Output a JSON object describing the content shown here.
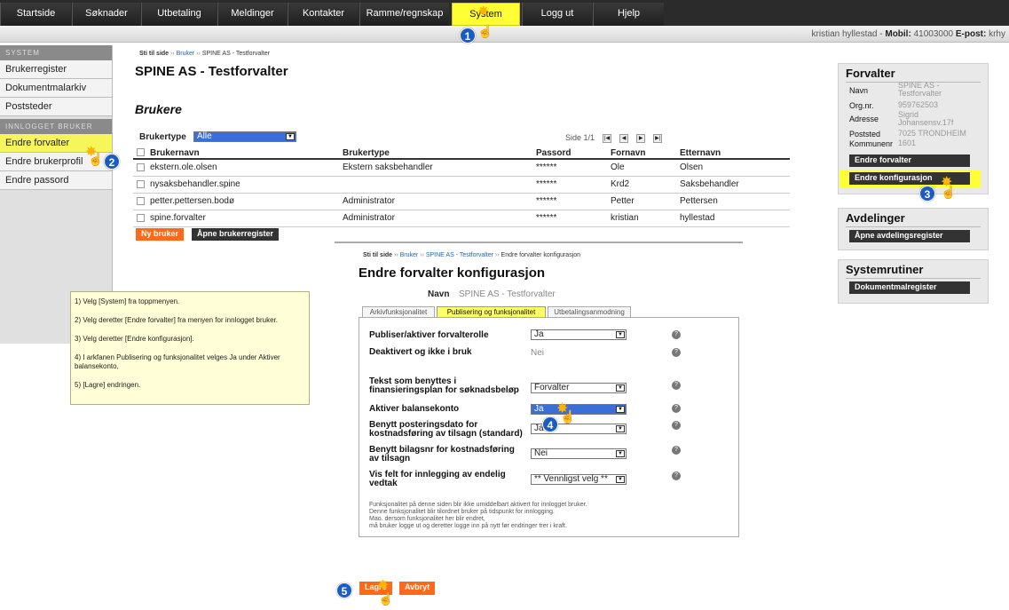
{
  "topnav": {
    "tabs": [
      "Startside",
      "Søknader",
      "Utbetaling",
      "Meldinger",
      "Kontakter",
      "Ramme/regnskap",
      "System",
      "Logg ut",
      "Hjelp"
    ],
    "active": "System"
  },
  "userbar": {
    "name": "kristian hyllestad",
    "mobile_label": "Mobil:",
    "mobile": "41003000",
    "email_label": "E-post:",
    "email": "krhy"
  },
  "sidebar": {
    "system_header": "SYSTEM",
    "system_items": [
      "Brukerregister",
      "Dokumentmalarkiv",
      "Poststeder"
    ],
    "user_header": "INNLOGGET BRUKER",
    "user_items": [
      "Endre forvalter",
      "Endre brukerprofil",
      "Endre passord"
    ]
  },
  "crumb1": {
    "start": "Sti til side",
    "items": [
      "Bruker",
      "SPINE AS - Testforvalter"
    ]
  },
  "page_title": "SPINE AS - Testforvalter",
  "section_title": "Brukere",
  "filter": {
    "label": "Brukertype",
    "value": "Alle"
  },
  "pager": {
    "text": "Side 1/1"
  },
  "users": {
    "headers": [
      "Brukernavn",
      "Brukertype",
      "Passord",
      "Fornavn",
      "Etternavn"
    ],
    "rows": [
      [
        "ekstern.ole.olsen",
        "Ekstern saksbehandler",
        "******",
        "Ole",
        "Olsen"
      ],
      [
        "nysaksbehandler.spine",
        "",
        "******",
        "Krd2",
        "Saksbehandler"
      ],
      [
        "petter.pettersen.bodø",
        "Administrator",
        "******",
        "Petter",
        "Pettersen"
      ],
      [
        "spine.forvalter",
        "Administrator",
        "******",
        "kristian",
        "hyllestad"
      ]
    ]
  },
  "buttons": {
    "new_user": "Ny bruker",
    "open_register": "Åpne brukerregister"
  },
  "right": {
    "forvalter_title": "Forvalter",
    "fields": [
      {
        "k": "Navn",
        "v": "SPINE AS - Testforvalter"
      },
      {
        "k": "Org.nr.",
        "v": "959762503"
      },
      {
        "k": "Adresse",
        "v": "Sigrid Johansensv.17f"
      },
      {
        "k": "Poststed",
        "v": "7025 TRONDHEIM"
      },
      {
        "k": "Kommunenr",
        "v": "1601"
      }
    ],
    "btn_edit": "Endre forvalter",
    "btn_config": "Endre konfigurasjon",
    "avd_title": "Avdelinger",
    "btn_avd": "Åpne avdelingsregister",
    "sys_title": "Systemrutiner",
    "btn_dok": "Dokumentmalregister"
  },
  "note": [
    "1) Velg [System] fra toppmenyen.",
    "2) Velg deretter [Endre forvalter] fra menyen for innlogget bruker.",
    "3) Velg deretter [Endre konfigurasjon].",
    "4) I arkfanen Publisering og funksjonalitet velges Ja under Aktiver balansekonto,",
    "5) [Lagre] endringen."
  ],
  "crumb2": {
    "start": "Sti til side",
    "items": [
      "Bruker",
      "SPINE AS - Testforvalter",
      "Endre forvalter konfigurasjon"
    ]
  },
  "config": {
    "title": "Endre forvalter konfigurasjon",
    "name_label": "Navn",
    "name_value": "SPINE AS - Testforvalter",
    "tabs": [
      "Arkivfunksjonalitet",
      "Publisering og funksjonalitet",
      "Utbetalingsanmodning"
    ],
    "rows": [
      {
        "label": "Publiser/aktiver forvalterolle",
        "value": "Ja"
      },
      {
        "label": "Deaktivert og ikke i bruk",
        "value": "Nei"
      },
      {
        "label": "Tekst som benyttes i finansieringsplan for søknadsbeløp",
        "value": "Forvalter"
      },
      {
        "label": "Aktiver balansekonto",
        "value": "Ja"
      },
      {
        "label": "Benytt posteringsdato for kostnadsføring av tilsagn (standard)",
        "value": "Ja"
      },
      {
        "label": "Benytt bilagsnr for kostnadsføring av tilsagn",
        "value": "Nei"
      },
      {
        "label": "Vis felt for innlegging av endelig vedtak",
        "value": "** Vennligst velg **"
      }
    ],
    "footnote": [
      "Funksjonalitet på denne siden blir ikke umiddelbart aktivert for innlogget bruker.",
      "Denne funksjonalitet blir tilordnet bruker på tidspunkt for innlogging.",
      "Mao. dersom funksjonalitet her blir endret,",
      "må bruker logge ut og deretter logge inn på nytt før endringer trer i kraft."
    ],
    "save": "Lagre",
    "cancel": "Avbryt"
  },
  "steps": [
    "1",
    "2",
    "3",
    "4",
    "5"
  ],
  "icons": {
    "pointer": "hand-pointer-icon",
    "burst": "click-burst-icon",
    "help": "help-icon",
    "pager": "pager-arrow-icon"
  },
  "colors": {
    "active_tab": "#ffff33",
    "orange": "#ff6a1a",
    "badge": "#1a5bc4",
    "note_bg": "#fffed6"
  }
}
